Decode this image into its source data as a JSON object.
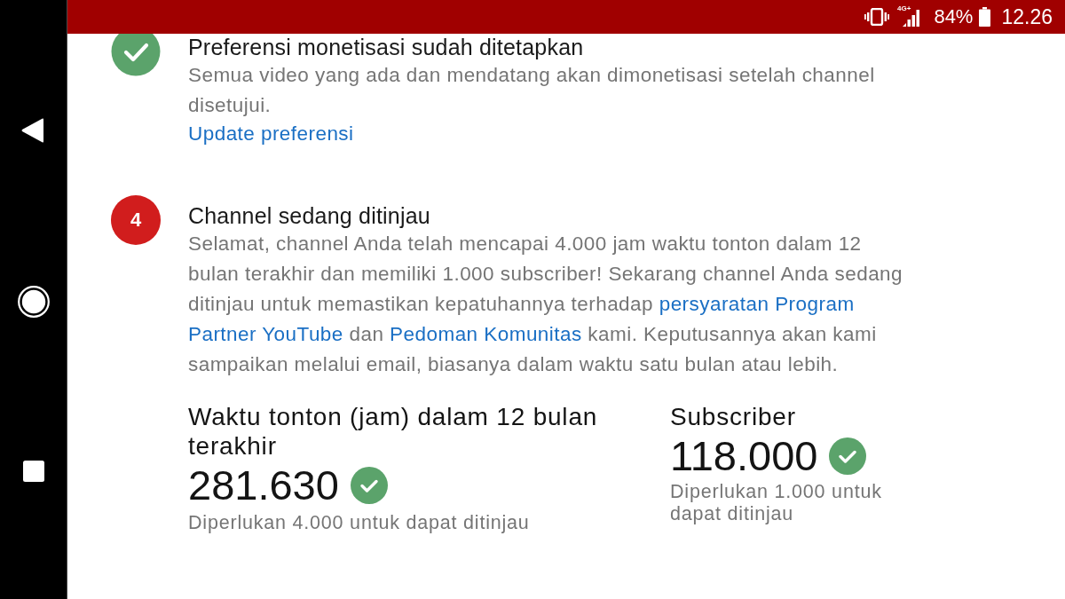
{
  "status_bar": {
    "network": "4G+",
    "battery": "84%",
    "time": "12.26"
  },
  "steps": [
    {
      "kind": "done",
      "title": "Preferensi monetisasi sudah ditetapkan",
      "description": [
        {
          "kind": "text",
          "text": "Semua video yang ada dan mendatang akan dimonetisasi setelah channel disetujui."
        }
      ],
      "link": "Update preferensi"
    },
    {
      "kind": "number",
      "number": "4",
      "title": "Channel sedang ditinjau",
      "description": [
        {
          "kind": "text",
          "text": "Selamat, channel Anda telah mencapai 4.000 jam waktu tonton dalam 12 bulan terakhir dan memiliki 1.000 subscriber! Sekarang channel Anda sedang ditinjau untuk memastikan kepatuhannya terhadap"
        },
        {
          "kind": "link",
          "text": "persyaratan Program"
        },
        {
          "kind": "link",
          "text": "Partner YouTube"
        },
        {
          "kind": "text",
          "text": "dan"
        },
        {
          "kind": "link",
          "text": "Pedoman Komunitas"
        },
        {
          "kind": "text",
          "text": "kami. Keputusannya akan kami sampaikan melalui email, biasanya dalam waktu satu bulan atau lebih."
        }
      ]
    }
  ],
  "stats": [
    {
      "label": "Waktu tonton (jam) dalam 12 bulan terakhir",
      "value": "281.630",
      "met": true,
      "note": "Diperlukan 4.000 untuk dapat ditinjau"
    },
    {
      "label": "Subscriber",
      "value": "118.000",
      "met": true,
      "note": "Diperlukan 1.000 untuk dapat ditinjau"
    }
  ]
}
